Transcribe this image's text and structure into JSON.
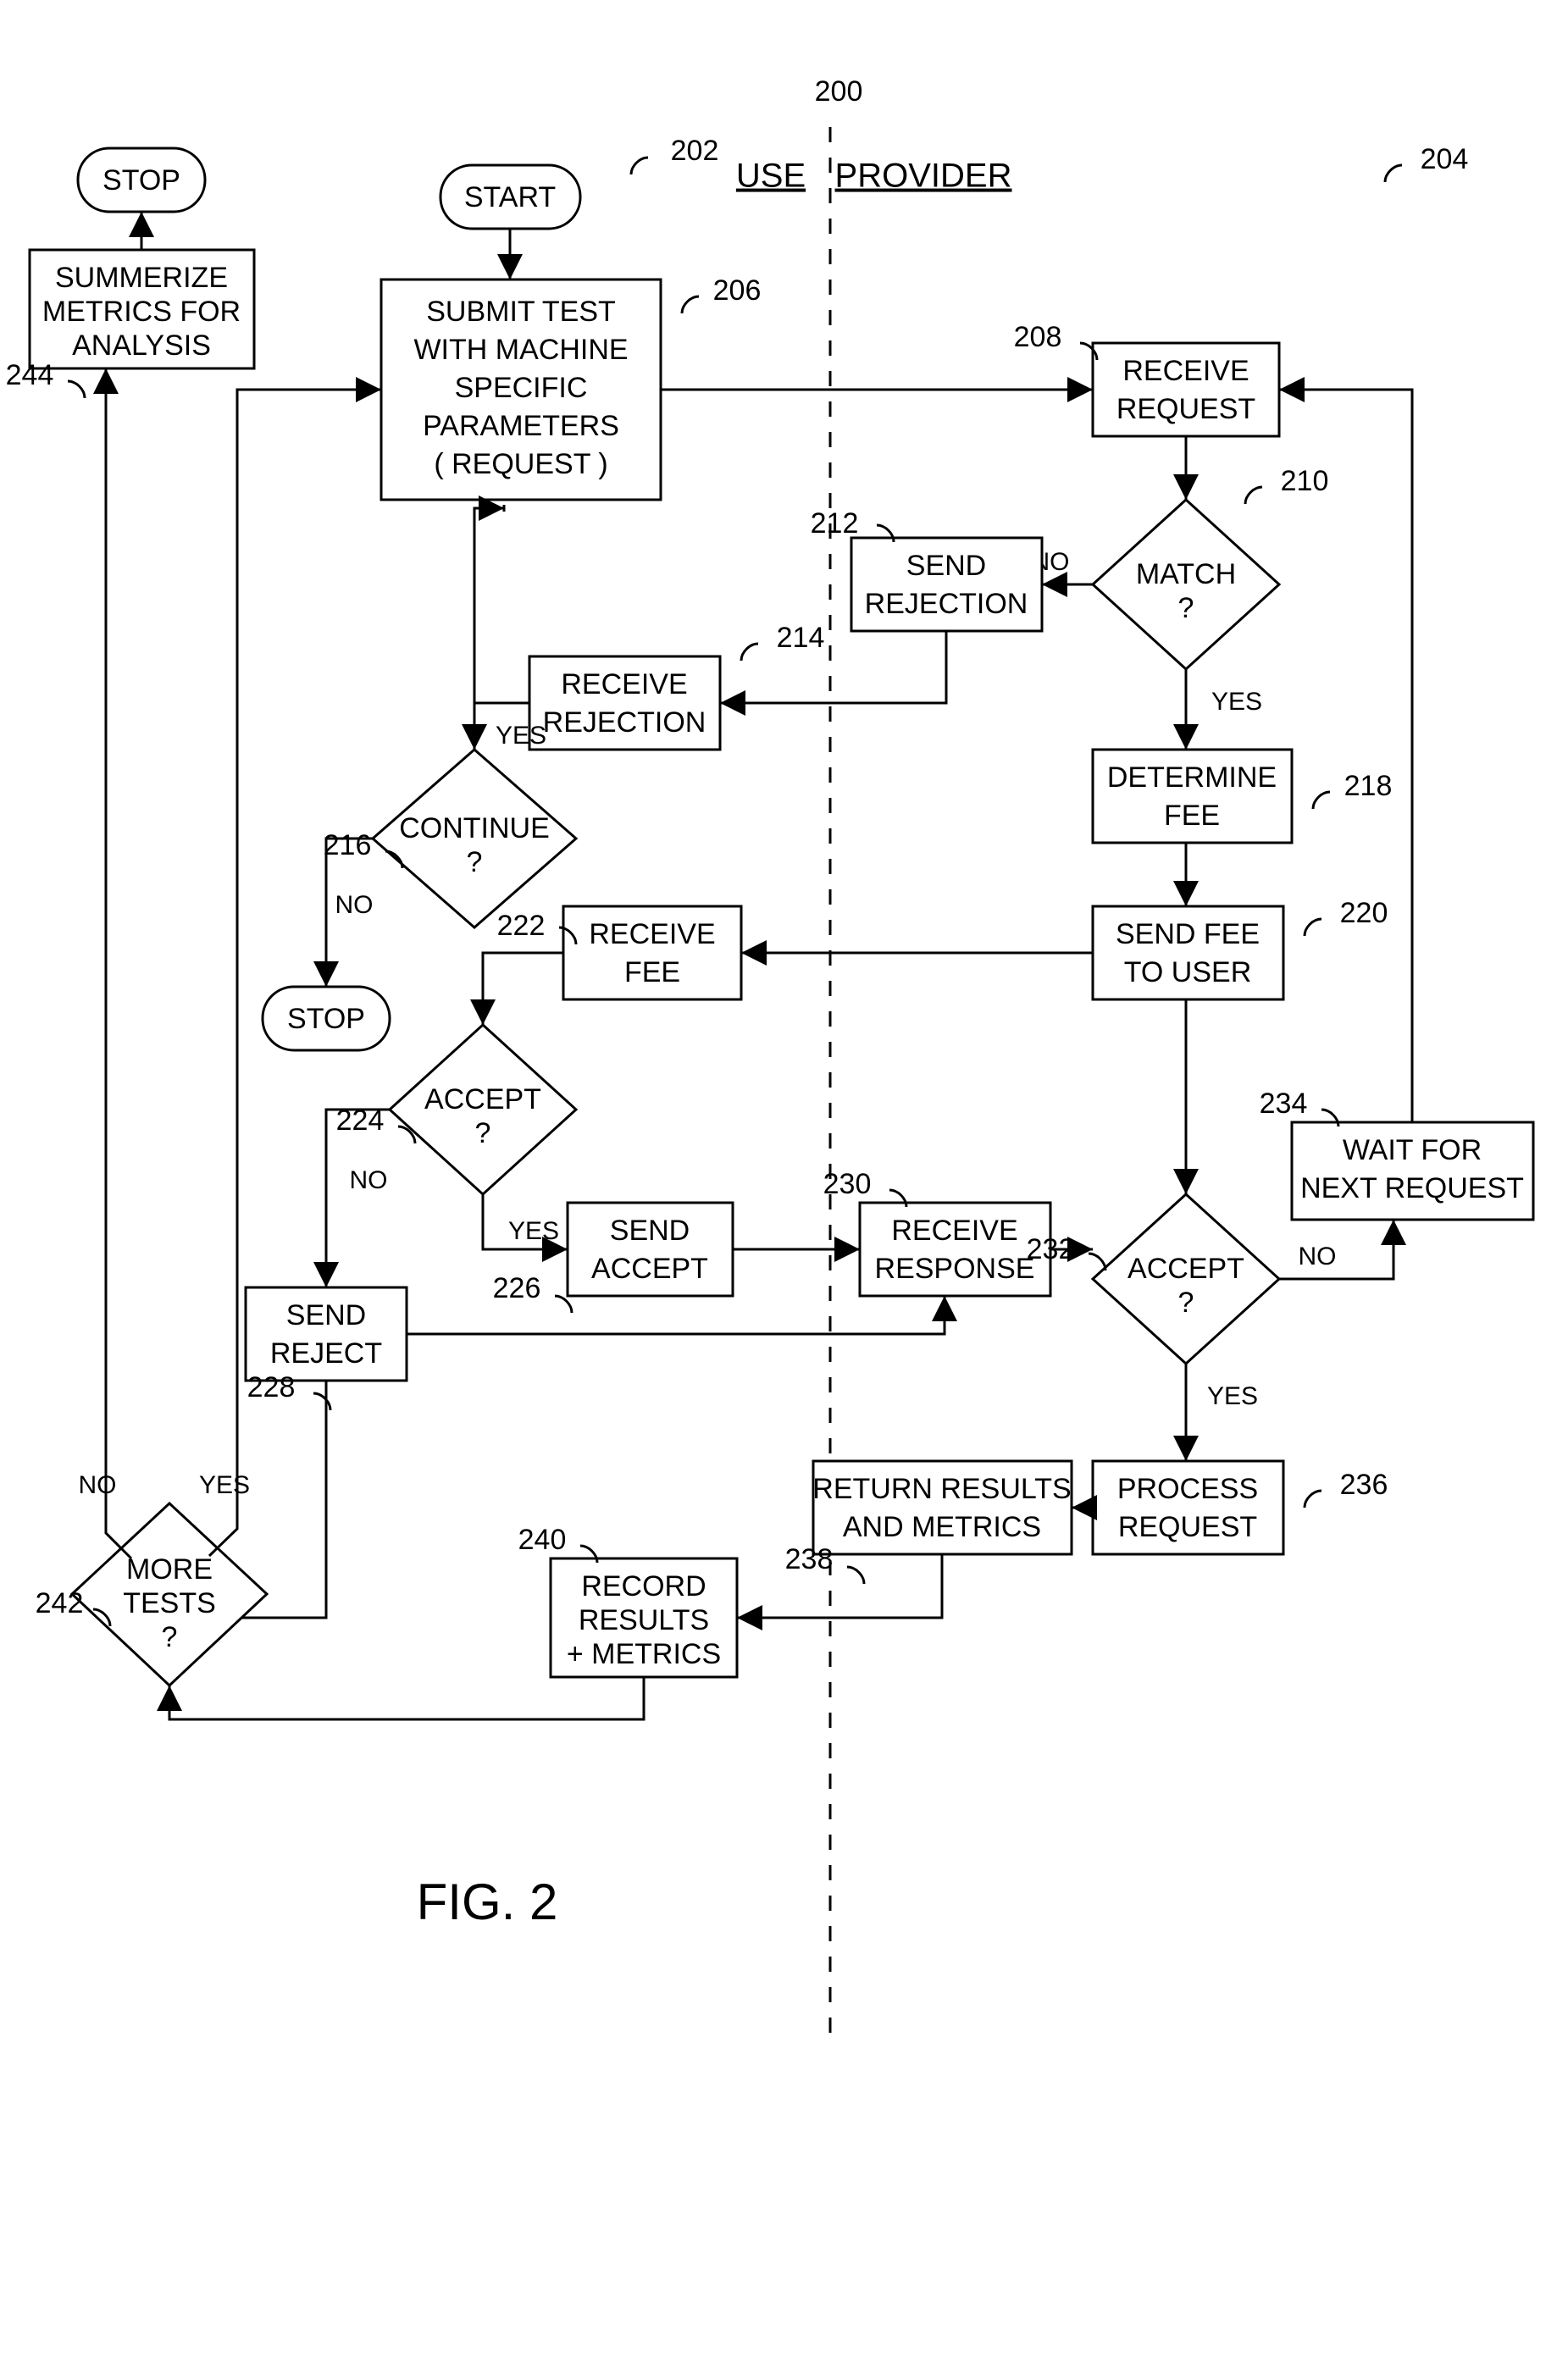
{
  "figure_label": "FIG. 2",
  "section_use": "USE",
  "section_provider": "PROVIDER",
  "ref_200": "200",
  "ref_202": "202",
  "ref_204": "204",
  "ref_206": "206",
  "ref_208": "208",
  "ref_210": "210",
  "ref_212": "212",
  "ref_214": "214",
  "ref_216": "216",
  "ref_218": "218",
  "ref_220": "220",
  "ref_222": "222",
  "ref_224": "224",
  "ref_226": "226",
  "ref_228": "228",
  "ref_230": "230",
  "ref_232": "232",
  "ref_234": "234",
  "ref_236": "236",
  "ref_238": "238",
  "ref_240": "240",
  "ref_242": "242",
  "ref_244": "244",
  "start": "START",
  "stop": "STOP",
  "submit_l1": "SUBMIT TEST",
  "submit_l2": "WITH MACHINE",
  "submit_l3": "SPECIFIC",
  "submit_l4": "PARAMETERS",
  "submit_l5": "( REQUEST )",
  "receive_request_l1": "RECEIVE",
  "receive_request_l2": "REQUEST",
  "match_l1": "MATCH",
  "match_l2": "?",
  "send_rejection_l1": "SEND",
  "send_rejection_l2": "REJECTION",
  "receive_rejection_l1": "RECEIVE",
  "receive_rejection_l2": "REJECTION",
  "determine_fee_l1": "DETERMINE",
  "determine_fee_l2": "FEE",
  "send_fee_l1": "SEND FEE",
  "send_fee_l2": "TO USER",
  "receive_fee_l1": "RECEIVE",
  "receive_fee_l2": "FEE",
  "continue_l1": "CONTINUE",
  "continue_l2": "?",
  "accept_l1": "ACCEPT",
  "accept_l2": "?",
  "send_accept_l1": "SEND",
  "send_accept_l2": "ACCEPT",
  "send_reject_l1": "SEND",
  "send_reject_l2": "REJECT",
  "receive_response_l1": "RECEIVE",
  "receive_response_l2": "RESPONSE",
  "wait_l1": "WAIT FOR",
  "wait_l2": "NEXT REQUEST",
  "process_l1": "PROCESS",
  "process_l2": "REQUEST",
  "return_l1": "RETURN RESULTS",
  "return_l2": "AND METRICS",
  "record_l1": "RECORD",
  "record_l2": "RESULTS",
  "record_l3": "+ METRICS",
  "more_tests_l1": "MORE",
  "more_tests_l2": "TESTS",
  "more_tests_l3": "?",
  "summarize_l1": "SUMMERIZE",
  "summarize_l2": "METRICS FOR",
  "summarize_l3": "ANALYSIS",
  "yes": "YES",
  "no": "NO"
}
